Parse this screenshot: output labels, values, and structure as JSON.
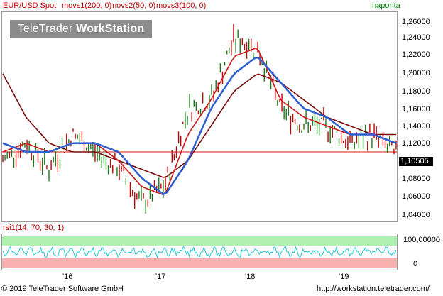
{
  "header": {
    "title": "EUR/USD Spot",
    "indicators": [
      {
        "label": "movs1(200, 0)",
        "color": "#c00000"
      },
      {
        "label": "movs2(50, 0)",
        "color": "#c00000"
      },
      {
        "label": "movs3(100, 0)",
        "color": "#c00000"
      }
    ],
    "right_label": "naponta"
  },
  "watermark": {
    "brand": "TeleTrader",
    "product": "WorkStation"
  },
  "rsi": {
    "label": "rsi1(14, 70, 30, 1)",
    "axis_top": "100,00000",
    "axis_bottom": "0"
  },
  "price_axis": [
    "1,26000",
    "1,24000",
    "1,22000",
    "1,20000",
    "1,18000",
    "1,16000",
    "1,14000",
    "1,12000",
    "1,10000",
    "1,08000",
    "1,06000",
    "1,04000"
  ],
  "last_price": "1,10505",
  "time_axis": [
    "'16",
    "'17",
    "'18",
    "'19"
  ],
  "footer": {
    "left": "© 2019  TeleTrader Software GmbH",
    "right": "http://workstation.teletrader.com/"
  },
  "colors": {
    "candles": "#1a7a1a",
    "candles_down": "#c00000",
    "ma_blue": "#3060d0",
    "ma_red": "#d01818",
    "ma_dark": "#7a0c0c",
    "rsi_line": "#20c8d8",
    "rsi_upper": "#b0f0b0",
    "rsi_lower": "#f8b0b0"
  },
  "chart_data": {
    "type": "line",
    "title": "EUR/USD Spot",
    "ylim": [
      1.03,
      1.27
    ],
    "series": [
      {
        "name": "EUR/USD Spot",
        "x": [
          "2015-07",
          "2015-10",
          "2016-01",
          "2016-04",
          "2016-07",
          "2016-10",
          "2017-01",
          "2017-04",
          "2017-07",
          "2017-10",
          "2018-01",
          "2018-04",
          "2018-07",
          "2018-10",
          "2019-01",
          "2019-04",
          "2019-07",
          "2019-09"
        ],
        "values": [
          1.1,
          1.12,
          1.09,
          1.13,
          1.11,
          1.09,
          1.05,
          1.07,
          1.16,
          1.17,
          1.24,
          1.23,
          1.16,
          1.14,
          1.14,
          1.12,
          1.13,
          1.105
        ]
      },
      {
        "name": "movs1(200, 0)",
        "values": [
          1.2,
          1.15,
          1.12,
          1.11,
          1.11,
          1.1,
          1.09,
          1.08,
          1.1,
          1.14,
          1.18,
          1.2,
          1.19,
          1.17,
          1.15,
          1.14,
          1.13,
          1.13
        ]
      },
      {
        "name": "movs2(50, 0)",
        "values": [
          1.11,
          1.12,
          1.11,
          1.12,
          1.12,
          1.1,
          1.07,
          1.06,
          1.13,
          1.17,
          1.22,
          1.23,
          1.17,
          1.15,
          1.14,
          1.13,
          1.13,
          1.12
        ]
      },
      {
        "name": "movs3(100, 0)",
        "values": [
          1.12,
          1.11,
          1.11,
          1.12,
          1.12,
          1.11,
          1.08,
          1.06,
          1.1,
          1.16,
          1.2,
          1.22,
          1.19,
          1.16,
          1.15,
          1.13,
          1.13,
          1.12
        ]
      }
    ],
    "rsi": {
      "upper": 70,
      "lower": 30
    }
  }
}
